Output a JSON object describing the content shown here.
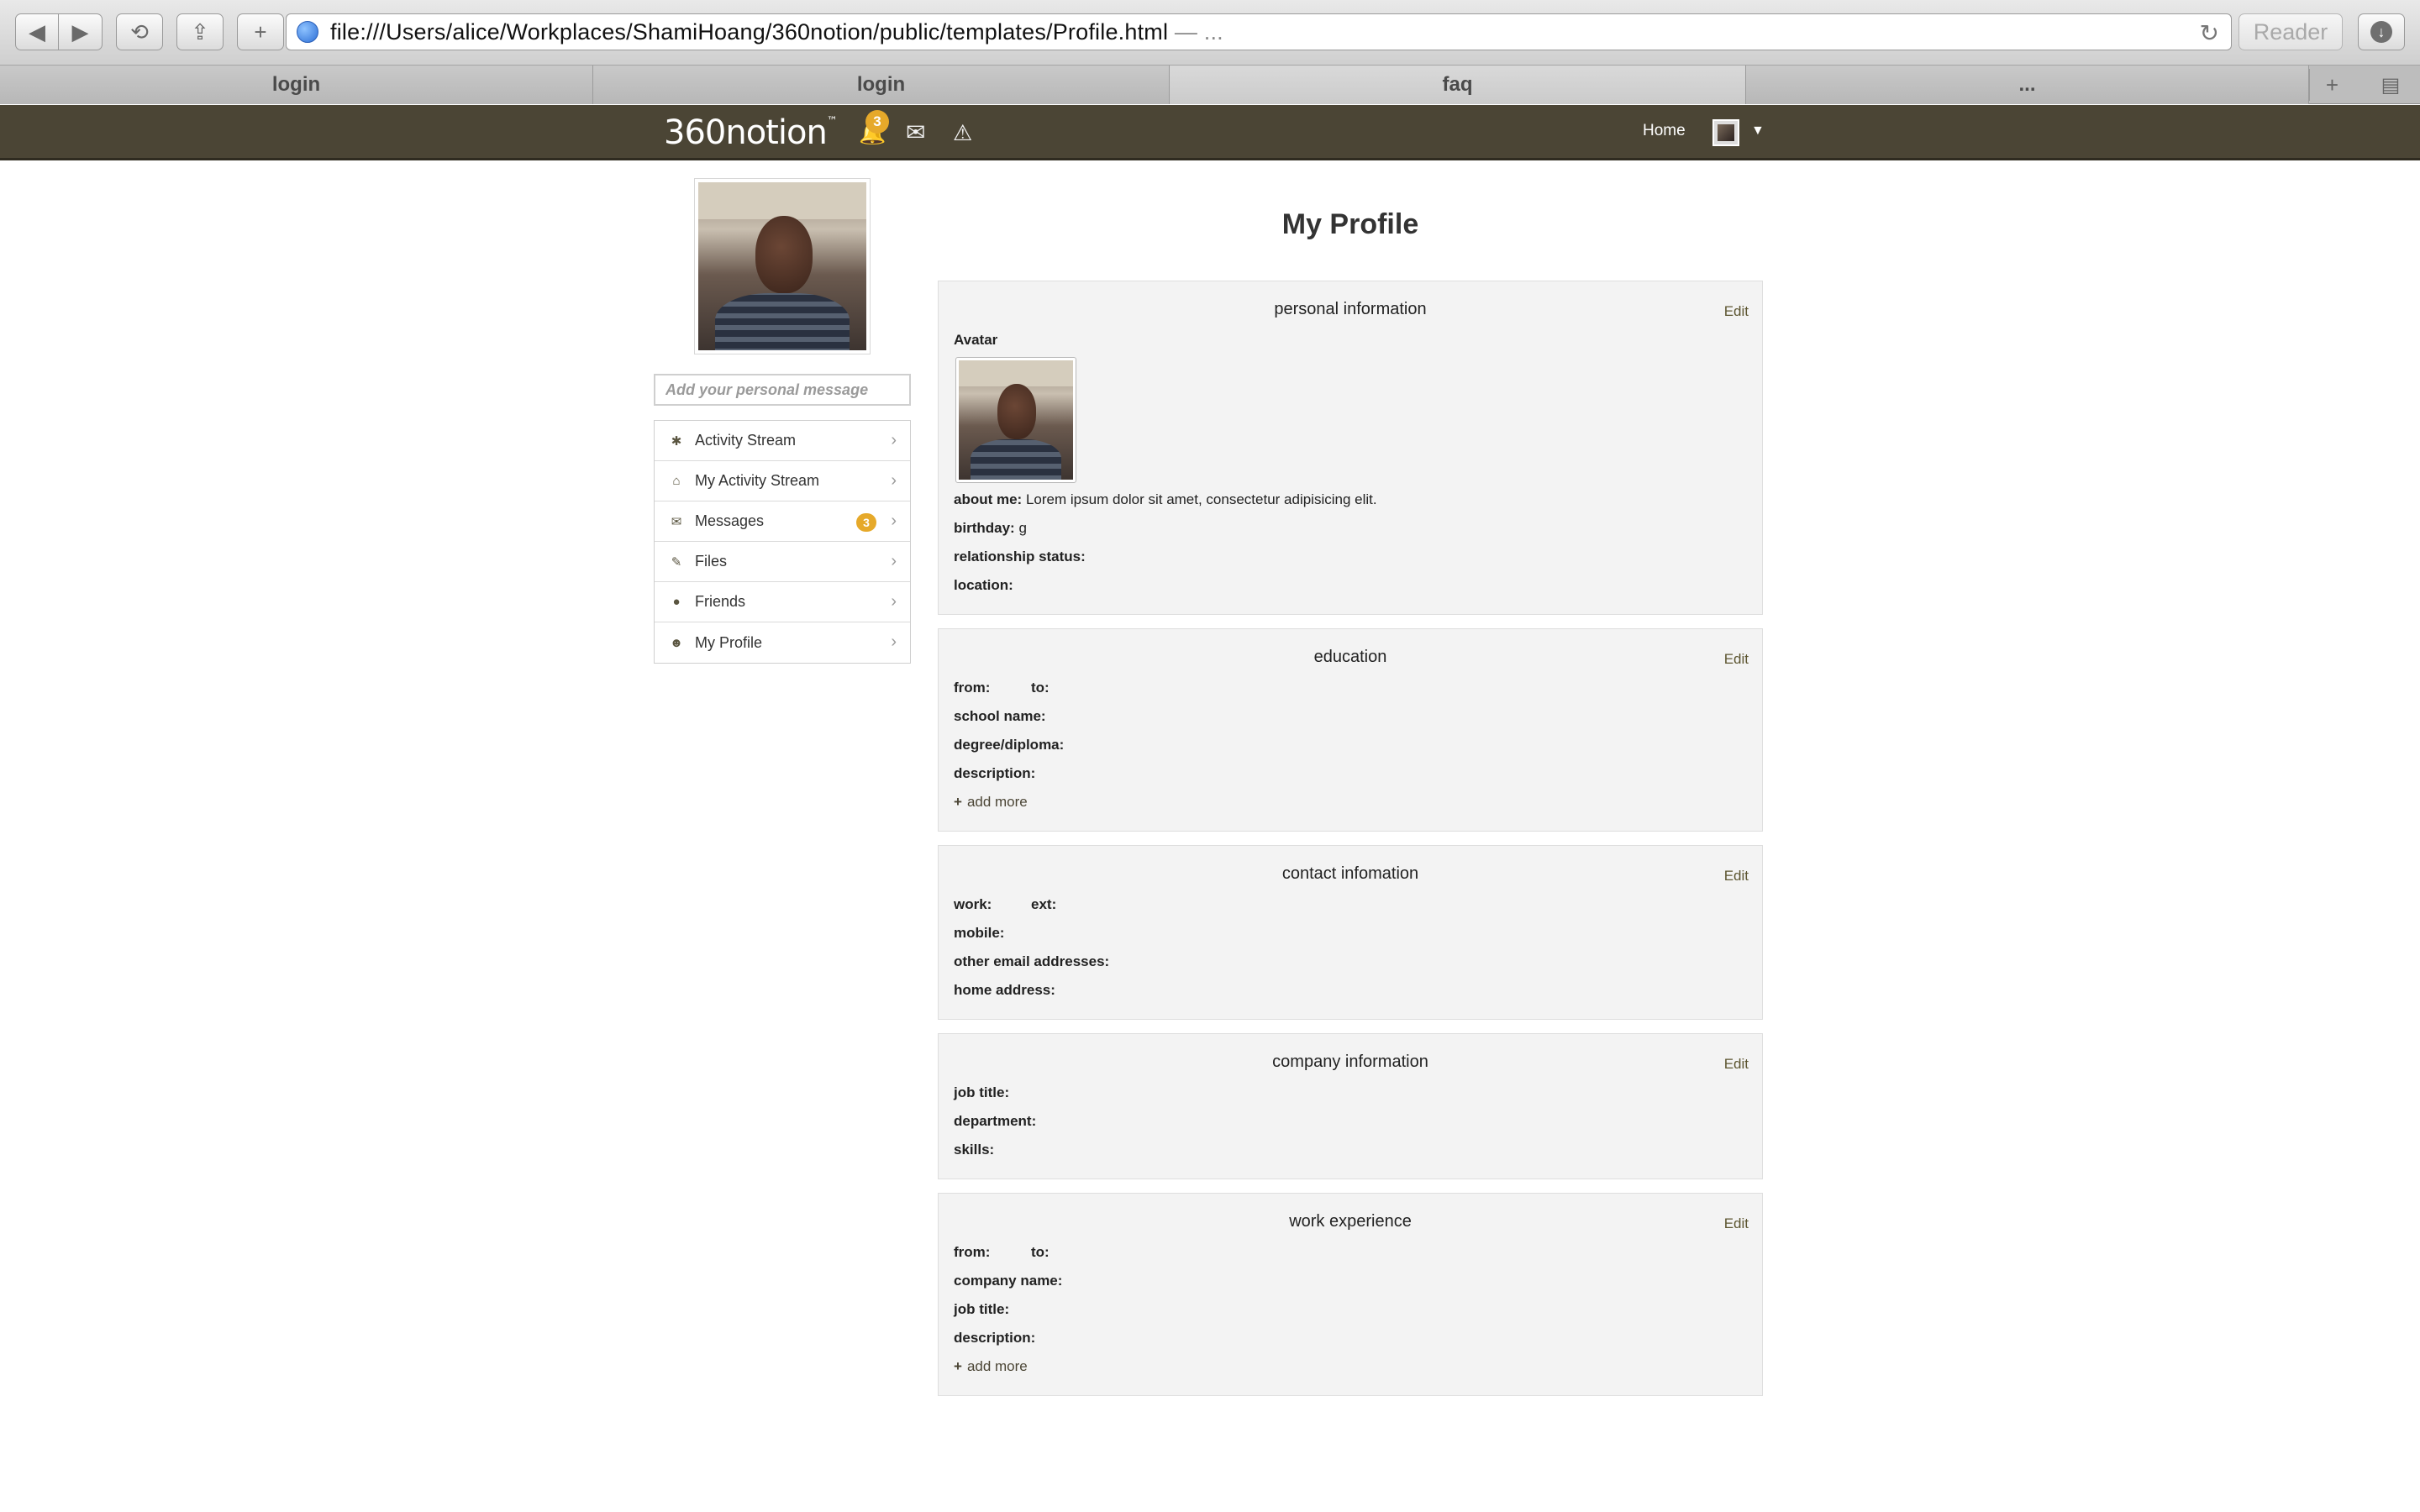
{
  "browser": {
    "url": "file:///Users/alice/Workplaces/ShamiHoang/360notion/public/templates/Profile.html",
    "url_suffix": " — ...",
    "reader_label": "Reader",
    "tabs": [
      {
        "label": "login"
      },
      {
        "label": "login"
      },
      {
        "label": "faq"
      },
      {
        "label": "..."
      }
    ]
  },
  "header": {
    "logo": "360notion",
    "logo_tm": "™",
    "notification_count": "3",
    "home_label": "Home"
  },
  "sidebar": {
    "message_placeholder": "Add your personal message",
    "items": [
      {
        "label": "Activity Stream",
        "icon": "asterisk-icon"
      },
      {
        "label": "My Activity Stream",
        "icon": "home-icon"
      },
      {
        "label": "Messages",
        "icon": "envelope-icon",
        "badge": "3"
      },
      {
        "label": "Files",
        "icon": "paperclip-icon"
      },
      {
        "label": "Friends",
        "icon": "users-icon"
      },
      {
        "label": "My Profile",
        "icon": "user-icon"
      }
    ]
  },
  "main": {
    "title": "My Profile",
    "edit_label": "Edit",
    "add_more_label": "add more",
    "personal": {
      "title": "personal information",
      "avatar_label": "Avatar",
      "about_label": "about me:",
      "about_value": "Lorem ipsum dolor sit amet, consectetur adipisicing elit.",
      "birthday_label": "birthday:",
      "birthday_value": "g",
      "relationship_label": "relationship status:",
      "location_label": "location:"
    },
    "education": {
      "title": "education",
      "from_label": "from:",
      "to_label": "to:",
      "school_label": "school name:",
      "degree_label": "degree/diploma:",
      "description_label": "description:"
    },
    "contact": {
      "title": "contact infomation",
      "work_label": "work:",
      "ext_label": "ext:",
      "mobile_label": "mobile:",
      "emails_label": "other email addresses:",
      "address_label": "home address:"
    },
    "company": {
      "title": "company information",
      "job_label": "job title:",
      "department_label": "department:",
      "skills_label": "skills:"
    },
    "work": {
      "title": "work experience",
      "from_label": "from:",
      "to_label": "to:",
      "company_label": "company name:",
      "job_label": "job title:",
      "description_label": "description:"
    }
  },
  "colors": {
    "header_bg": "#4b4535",
    "badge": "#e6a92a",
    "panel_bg": "#f3f3f3",
    "link": "#5c5530"
  }
}
